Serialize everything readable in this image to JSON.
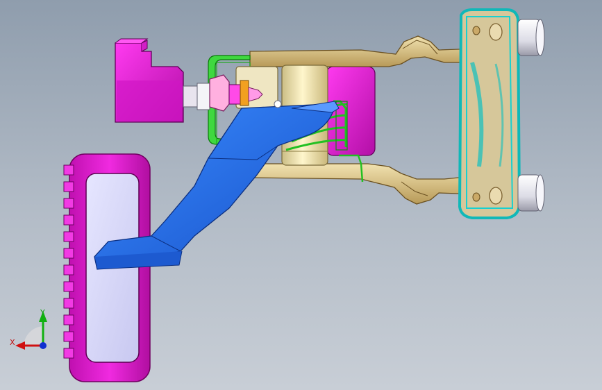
{
  "viewport": {
    "background_top": "#8f9dad",
    "background_bottom": "#c8ced6"
  },
  "model": {
    "parts": [
      {
        "name": "pedal-pad",
        "color": "#e619d6"
      },
      {
        "name": "pedal-arm",
        "color": "#2a6de0"
      },
      {
        "name": "bracket-plate",
        "color": "#1fd6d6"
      },
      {
        "name": "mounting-rail",
        "color": "#d8c28a"
      },
      {
        "name": "return-spring",
        "color": "#2bd12b"
      },
      {
        "name": "sensor-block",
        "color": "#e619d6"
      },
      {
        "name": "pivot-shaft",
        "color": "#efe3b0"
      },
      {
        "name": "mounting-stud",
        "color": "#e8e8f0"
      }
    ]
  },
  "triad": {
    "x_label": "X",
    "y_label": "Y",
    "x_color": "#d01010",
    "y_color": "#10b010",
    "z_color": "#1030d0"
  }
}
